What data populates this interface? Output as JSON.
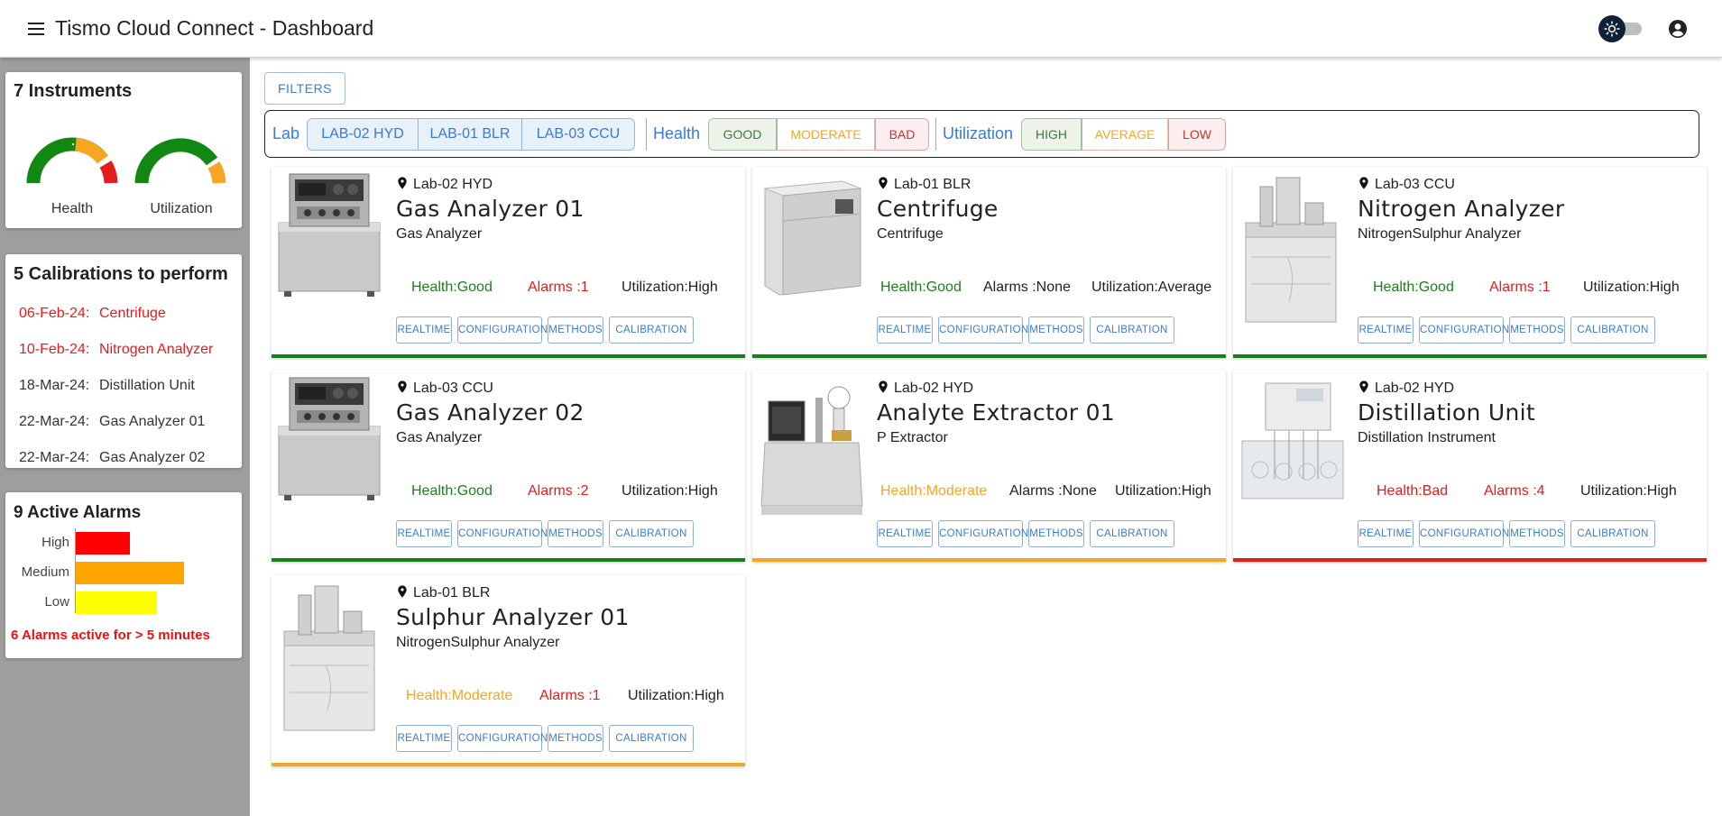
{
  "header": {
    "title": "Tismo Cloud Connect - Dashboard"
  },
  "instruments": {
    "title": "7 Instruments",
    "gauges": [
      {
        "label": "Health"
      },
      {
        "label": "Utilization"
      }
    ]
  },
  "calibrations": {
    "title": "5 Calibrations to perform",
    "items": [
      {
        "date": "06-Feb-24:",
        "name": "Centrifuge",
        "overdue": true
      },
      {
        "date": "10-Feb-24:",
        "name": "Nitrogen Analyzer",
        "overdue": true
      },
      {
        "date": "18-Mar-24:",
        "name": "Distillation Unit",
        "overdue": false
      },
      {
        "date": "22-Mar-24:",
        "name": "Gas Analyzer 01",
        "overdue": false
      },
      {
        "date": "22-Mar-24:",
        "name": "Gas Analyzer 02",
        "overdue": false
      }
    ]
  },
  "alarms": {
    "title": "9 Active Alarms",
    "levels": [
      {
        "label": "High",
        "count": 2,
        "color": "#ff0000"
      },
      {
        "label": "Medium",
        "count": 4,
        "color": "#ffa500"
      },
      {
        "label": "Low",
        "count": 3,
        "color": "#ffff00"
      }
    ],
    "note": "6 Alarms active for > 5 minutes"
  },
  "filters": {
    "button_label": "FILTERS",
    "lab_label": "Lab",
    "labs": [
      "LAB-02 HYD",
      "LAB-01 BLR",
      "LAB-03 CCU"
    ],
    "health_label": "Health",
    "health": [
      "GOOD",
      "MODERATE",
      "BAD"
    ],
    "utilization_label": "Utilization",
    "utilization": [
      "HIGH",
      "AVERAGE",
      "LOW"
    ]
  },
  "colors": {
    "good": "#1a7f1a",
    "moderate": "#f5a623",
    "bad": "#e51c1c",
    "accent": "#3a7bd5"
  },
  "card_buttons": [
    "REALTIME",
    "CONFIGURATION",
    "METHODS",
    "CALIBRATION"
  ],
  "cards": [
    {
      "location": "Lab-02 HYD",
      "name": "Gas Analyzer 01",
      "type": "Gas Analyzer",
      "health": "Health:Good",
      "alarms": "Alarms :1",
      "utilization": "Utilization:High",
      "status": "good",
      "image": "gas-analyzer"
    },
    {
      "location": "Lab-01 BLR",
      "name": "Centrifuge",
      "type": "Centrifuge",
      "health": "Health:Good",
      "alarms": "Alarms :None",
      "utilization": "Utilization:Average",
      "status": "good",
      "image": "centrifuge"
    },
    {
      "location": "Lab-03 CCU",
      "name": "Nitrogen Analyzer",
      "type": "NitrogenSulphur Analyzer",
      "health": "Health:Good",
      "alarms": "Alarms :1",
      "utilization": "Utilization:High",
      "status": "good",
      "image": "nitrogen-analyzer"
    },
    {
      "location": "Lab-03 CCU",
      "name": "Gas Analyzer 02",
      "type": "Gas Analyzer",
      "health": "Health:Good",
      "alarms": "Alarms :2",
      "utilization": "Utilization:High",
      "status": "good",
      "image": "gas-analyzer"
    },
    {
      "location": "Lab-02 HYD",
      "name": "Analyte Extractor 01",
      "type": "P Extractor",
      "health": "Health:Moderate",
      "alarms": "Alarms :None",
      "utilization": "Utilization:High",
      "status": "moderate",
      "image": "extractor"
    },
    {
      "location": "Lab-02 HYD",
      "name": "Distillation Unit",
      "type": "Distillation Instrument",
      "health": "Health:Bad",
      "alarms": "Alarms :4",
      "utilization": "Utilization:High",
      "status": "bad",
      "image": "distillation"
    },
    {
      "location": "Lab-01 BLR",
      "name": "Sulphur Analyzer 01",
      "type": "NitrogenSulphur Analyzer",
      "health": "Health:Moderate",
      "alarms": "Alarms :1",
      "utilization": "Utilization:High",
      "status": "moderate",
      "image": "nitrogen-analyzer"
    }
  ]
}
